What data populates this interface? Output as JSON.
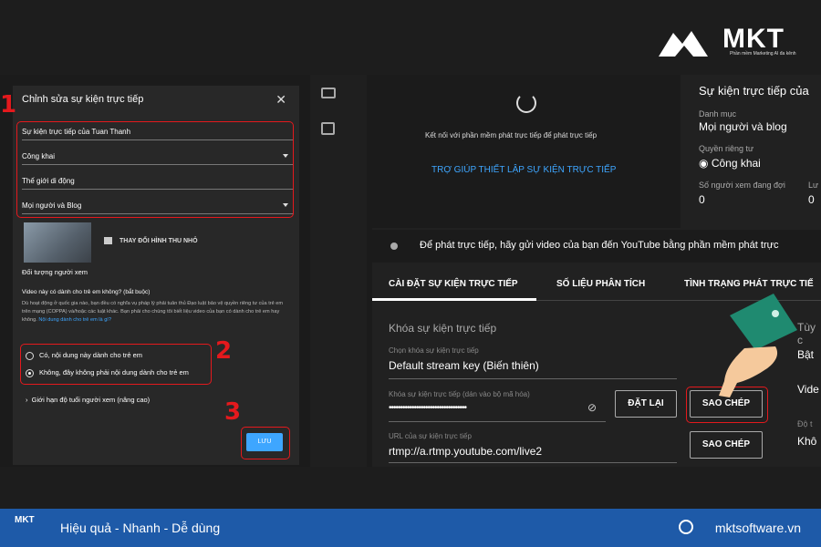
{
  "brand": {
    "name": "MKT",
    "sub": "Phần mềm Marketing AI đa kênh"
  },
  "dialog": {
    "title": "Chỉnh sửa sự kiện trực tiếp",
    "fields": [
      "Sự kiện trực tiếp của Tuan Thanh",
      "Công khai",
      "Thế giới di động",
      "Mọi người và Blog"
    ],
    "thumb_change": "THAY ĐỔI HÌNH THU NHỎ",
    "audience": "Đối tượng người xem",
    "kids_question": "Video này có dành cho trẻ em không? (bắt buộc)",
    "kids_desc": "Dù hoạt động ở quốc gia nào, bạn đều có nghĩa vụ pháp lý phải tuân thủ Đạo luật bảo vệ quyền riêng tư của trẻ em trên mạng (COPPA) và/hoặc các luật khác. Bạn phải cho chúng tôi biết liệu video của bạn có dành cho trẻ em hay không.",
    "kids_link": "Nội dung dành cho trẻ em là gì?",
    "radio_yes": "Có, nội dung này dành cho trẻ em",
    "radio_no": "Không, đây không phải nội dung dành cho trẻ em",
    "age": "Giới hạn độ tuổi người xem (nâng cao)",
    "save": "LƯU"
  },
  "steps": [
    "1",
    "2",
    "3"
  ],
  "panel": {
    "connect": "Kết nối với phần mềm phát trực tiếp để phát trực tiếp",
    "help": "TRỢ GIÚP THIẾT LẬP SỰ KIỆN TRỰC TIẾP"
  },
  "info": {
    "title": "Sự kiện trực tiếp của",
    "category_label": "Danh mục",
    "category": "Mọi người và blog",
    "privacy_label": "Quyền riêng tư",
    "privacy": "Công khai",
    "waiting_label": "Số người xem đang đợi",
    "waiting": "0",
    "likes_label": "Lư",
    "likes": "0"
  },
  "notice": "Để phát trực tiếp, hãy gửi video của bạn đến YouTube bằng phần mềm phát trực",
  "tabs": [
    "CÀI ĐẶT SỰ KIỆN TRỰC TIẾP",
    "SỐ LIỆU PHÂN TÍCH",
    "TÌNH TRẠNG PHÁT TRỰC TIẾ"
  ],
  "stream": {
    "section": "Khóa sự kiện trực tiếp",
    "choose_label": "Chọn khóa sự kiện trực tiếp",
    "choose": "Default stream key (Biến thiên)",
    "key_label": "Khóa sự kiện trực tiếp (dán vào bộ mã hóa)",
    "key": "••••••••••••••••••••••••••••••••••",
    "url_label": "URL của sự kiện trực tiếp",
    "url": "rtmp://a.rtmp.youtube.com/live2",
    "reset": "ĐẶT LẠI",
    "copy": "SAO CHÉP",
    "copy2": "SAO CHÉP"
  },
  "right": {
    "a": "Tùy c",
    "b": "Bật",
    "c": "Vide",
    "d": "Độ t",
    "e": "Khô"
  },
  "footer": {
    "logo": "MKT",
    "slogan": "Hiệu quả - Nhanh - Dễ dùng",
    "site": "mktsoftware.vn"
  }
}
